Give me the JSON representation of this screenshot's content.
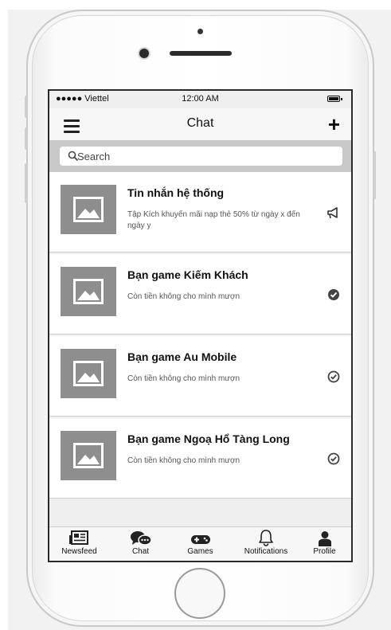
{
  "status_bar": {
    "carrier": "●●●●● Viettel",
    "time": "12:00 AM"
  },
  "nav": {
    "title": "Chat"
  },
  "search": {
    "placeholder": "Search"
  },
  "chats": [
    {
      "name": "Tin nhắn hệ thống",
      "message": "Tập Kích khuyến mãi nạp thẻ 50% từ ngày x đến ngày y",
      "status_icon": "megaphone-icon"
    },
    {
      "name": "Bạn game Kiếm Khách",
      "message": "Còn tiền không cho mình mượn",
      "status_icon": "check-circle-filled-icon"
    },
    {
      "name": "Bạn game Au Mobile",
      "message": "Còn tiền không cho mình mượn",
      "status_icon": "check-circle-outline-icon"
    },
    {
      "name": "Bạn game Ngoạ Hổ Tàng Long",
      "message": "Còn tiền không cho mình mượn",
      "status_icon": "check-circle-outline-icon"
    }
  ],
  "tabs": [
    {
      "label": "Newsfeed",
      "icon": "newspaper-icon"
    },
    {
      "label": "Chat",
      "icon": "chat-bubbles-icon"
    },
    {
      "label": "Games",
      "icon": "gamepad-icon"
    },
    {
      "label": "Notifications",
      "icon": "bell-icon"
    },
    {
      "label": "Profile",
      "icon": "user-icon"
    }
  ]
}
